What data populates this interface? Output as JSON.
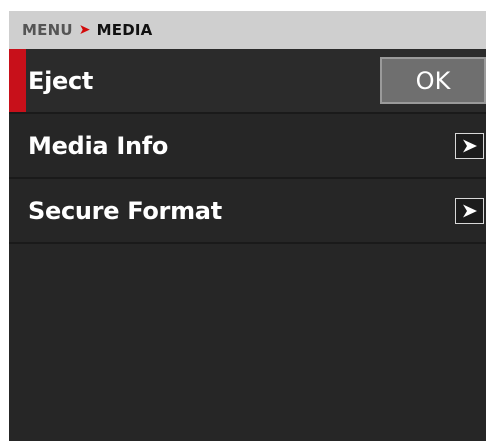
{
  "breadcrumb": {
    "root": "MENU",
    "separator": "➤",
    "current": "MEDIA"
  },
  "menu": {
    "items": [
      {
        "label": "Eject",
        "action": "OK",
        "selected": true
      },
      {
        "label": "Media Info",
        "action_icon": "chevron-right-icon"
      },
      {
        "label": "Secure Format",
        "action_icon": "chevron-right-icon"
      }
    ]
  },
  "colors": {
    "accent": "#c8101a",
    "background": "#262626",
    "header_bar": "#cfcfcf",
    "button_gray": "#6f6f6f"
  }
}
